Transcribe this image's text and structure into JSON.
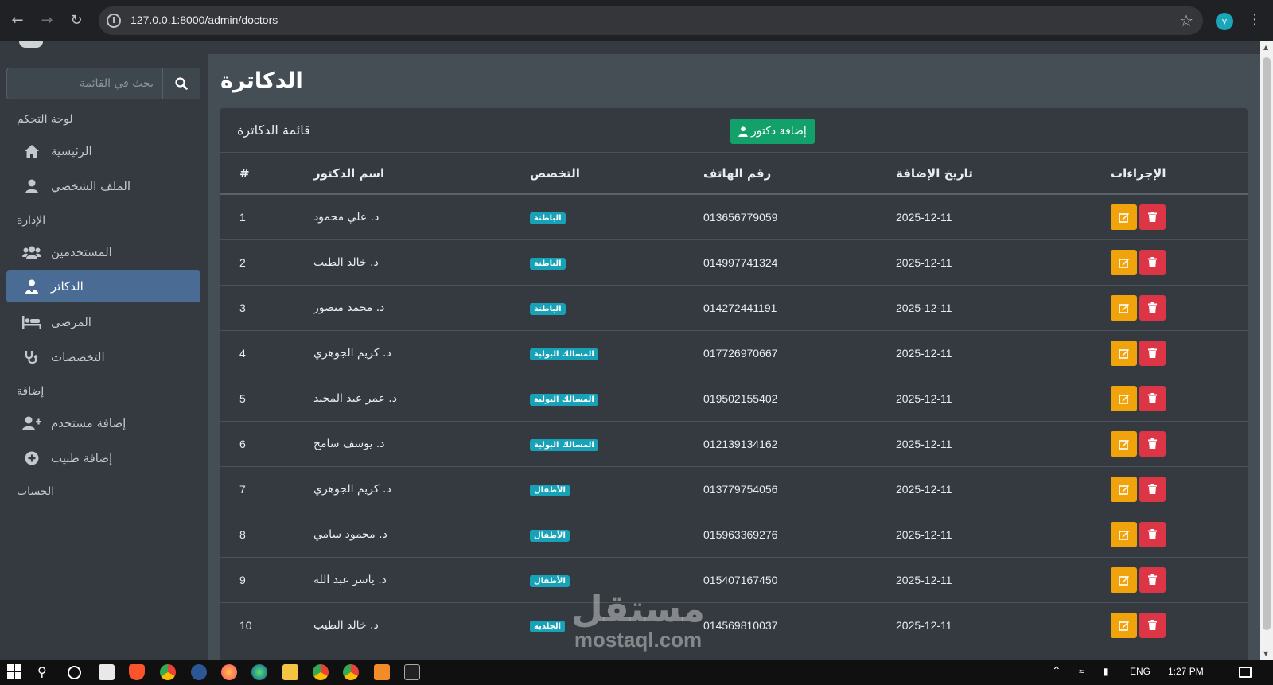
{
  "browser": {
    "url": "127.0.0.1:8000/admin/doctors",
    "profile_initial": "y"
  },
  "sidebar": {
    "search_placeholder": "بحث في القائمة",
    "section_dashboard": "لوحة التحكم",
    "section_admin": "الإدارة",
    "section_add": "إضافة",
    "section_account": "الحساب",
    "items": [
      {
        "label": "الرئيسية",
        "icon": "home-icon"
      },
      {
        "label": "الملف الشخصي",
        "icon": "user-icon"
      },
      {
        "label": "المستخدمين",
        "icon": "users-icon"
      },
      {
        "label": "الدكاتر",
        "icon": "doctor-icon",
        "active": true
      },
      {
        "label": "المرضى",
        "icon": "bed-icon"
      },
      {
        "label": "التخصصات",
        "icon": "stethoscope-icon"
      },
      {
        "label": "إضافة مستخدم",
        "icon": "user-plus-icon"
      },
      {
        "label": "إضافة طبيب",
        "icon": "plus-circle-icon"
      }
    ]
  },
  "page": {
    "title": "الدكاترة",
    "card_title": "قائمة الدكاترة",
    "add_button": "إضافة دكتور"
  },
  "table": {
    "headers": {
      "num": "#",
      "name": "اسم الدكتور",
      "specialty": "التخصص",
      "phone": "رقم الهاتف",
      "date": "تاريخ الإضافة",
      "actions": "الإجراءات"
    },
    "rows": [
      {
        "num": "1",
        "name": "د. علي محمود",
        "specialty": "الباطنة",
        "phone": "013656779059",
        "date": "2025-12-11"
      },
      {
        "num": "2",
        "name": "د. خالد الطيب",
        "specialty": "الباطنة",
        "phone": "014997741324",
        "date": "2025-12-11"
      },
      {
        "num": "3",
        "name": "د. محمد منصور",
        "specialty": "الباطنة",
        "phone": "014272441191",
        "date": "2025-12-11"
      },
      {
        "num": "4",
        "name": "د. كريم الجوهري",
        "specialty": "المسالك البولية",
        "phone": "017726970667",
        "date": "2025-12-11"
      },
      {
        "num": "5",
        "name": "د. عمر عبد المجيد",
        "specialty": "المسالك البولية",
        "phone": "019502155402",
        "date": "2025-12-11"
      },
      {
        "num": "6",
        "name": "د. يوسف سامح",
        "specialty": "المسالك البولية",
        "phone": "012139134162",
        "date": "2025-12-11"
      },
      {
        "num": "7",
        "name": "د. كريم الجوهري",
        "specialty": "الأطفال",
        "phone": "013779754056",
        "date": "2025-12-11"
      },
      {
        "num": "8",
        "name": "د. محمود سامي",
        "specialty": "الأطفال",
        "phone": "015963369276",
        "date": "2025-12-11"
      },
      {
        "num": "9",
        "name": "د. ياسر عبد الله",
        "specialty": "الأطفال",
        "phone": "015407167450",
        "date": "2025-12-11"
      },
      {
        "num": "10",
        "name": "د. خالد الطيب",
        "specialty": "الجلدية",
        "phone": "014569810037",
        "date": "2025-12-11"
      }
    ]
  },
  "taskbar": {
    "lang": "ENG",
    "time": "1:27 PM"
  },
  "watermark": {
    "arabic": "مستقل",
    "english": "mostaql.com"
  }
}
